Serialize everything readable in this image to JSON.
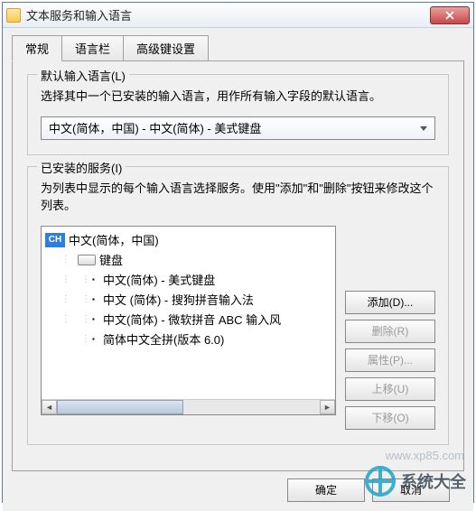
{
  "window": {
    "title": "文本服务和输入语言"
  },
  "tabs": [
    {
      "label": "常规",
      "active": true
    },
    {
      "label": "语言栏",
      "active": false
    },
    {
      "label": "高级键设置",
      "active": false
    }
  ],
  "default_lang": {
    "title": "默认输入语言(L)",
    "desc": "选择其中一个已安装的输入语言，用作所有输入字段的默认语言。",
    "selected": "中文(简体，中国) - 中文(简体) - 美式键盘"
  },
  "installed": {
    "title": "已安装的服务(I)",
    "desc": "为列表中显示的每个输入语言选择服务。使用\"添加\"和\"删除\"按钮来修改这个列表。",
    "root_badge": "CH",
    "root_label": "中文(简体，中国)",
    "keyboard_label": "键盘",
    "items": [
      "中文(简体) - 美式键盘",
      "中文 (简体) - 搜狗拼音输入法",
      "中文(简体) - 微软拼音 ABC 输入风",
      "简体中文全拼(版本 6.0)"
    ]
  },
  "buttons": {
    "add": "添加(D)...",
    "remove": "删除(R)",
    "props": "属性(P)...",
    "moveup": "上移(U)",
    "movedown": "下移(O)"
  },
  "footer": {
    "ok": "确定",
    "cancel": "取消"
  },
  "watermark": {
    "text": "系统大全",
    "url": "www.xp85.com"
  }
}
